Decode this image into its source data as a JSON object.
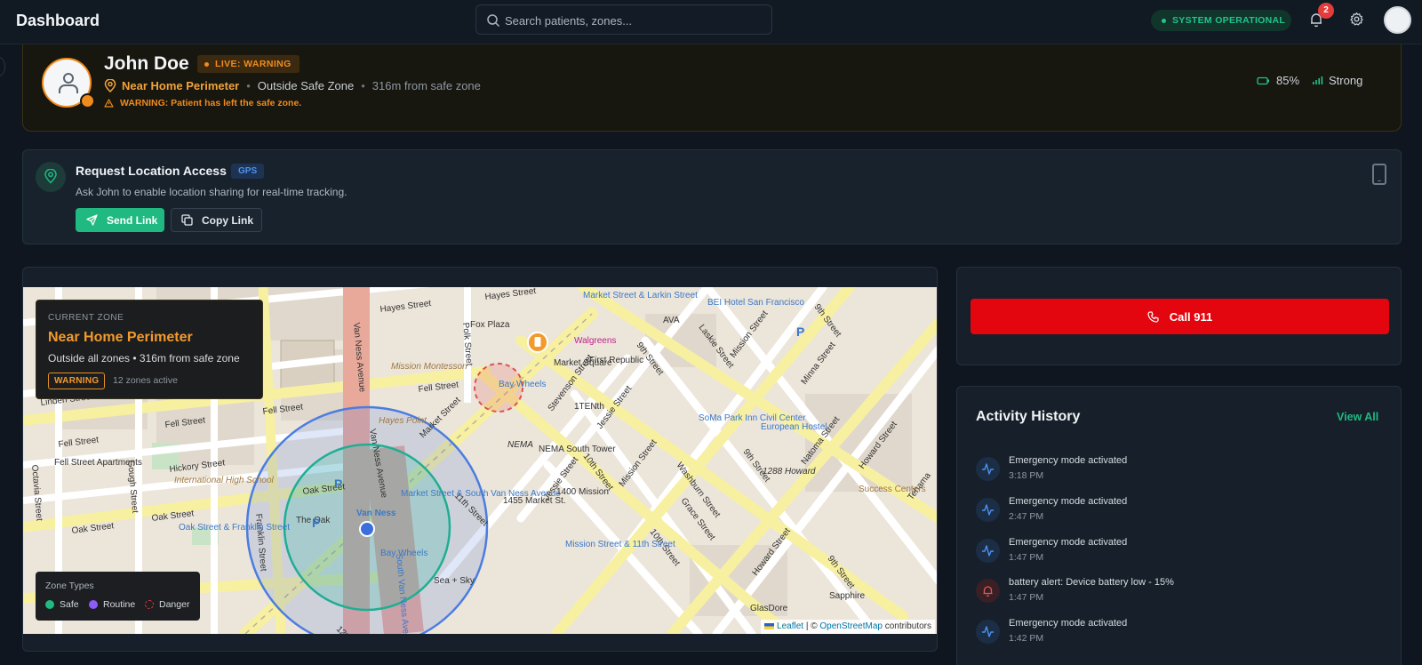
{
  "header": {
    "title": "Dashboard",
    "search_placeholder": "Search patients, zones...",
    "system_status": "SYSTEM OPERATIONAL",
    "notification_count": "2"
  },
  "patient": {
    "name": "John Doe",
    "live_badge": "LIVE: WARNING",
    "zone": "Near Home Perimeter",
    "zone_status": "Outside Safe Zone",
    "distance": "316m from safe zone",
    "warning": "WARNING: Patient has left the safe zone.",
    "battery": "85%",
    "signal": "Strong"
  },
  "location_request": {
    "title": "Request Location Access",
    "badge": "GPS",
    "description": "Ask John to enable location sharing for real-time tracking.",
    "send_label": "Send Link",
    "copy_label": "Copy Link"
  },
  "map": {
    "overlay": {
      "label": "CURRENT ZONE",
      "zone_name": "Near Home Perimeter",
      "subtitle": "Outside all zones • 316m from safe zone",
      "status": "WARNING",
      "zones_active": "12 zones active"
    },
    "legend": {
      "title": "Zone Types",
      "items": [
        {
          "label": "Safe",
          "color": "#1fb981"
        },
        {
          "label": "Routine",
          "color": "#8b5cf6"
        },
        {
          "label": "Danger",
          "color": "#e23c3c"
        }
      ]
    },
    "attribution": {
      "leaflet": "Leaflet",
      "separator": "| ©",
      "osm": "OpenStreetMap",
      "suffix": "contributors"
    },
    "labels": {
      "hayes_street": "Hayes Street",
      "fell_street": "Fell Street",
      "oak_street": "Oak Street",
      "market_street": "Market Street",
      "van_ness": "Van Ness",
      "van_ness_avenue": "Van Ness Avenue",
      "mission_street": "Mission Street",
      "howard_street": "Howard Street",
      "tenth_street": "10th Street",
      "ninth_street": "9th Street",
      "twelfth_street": "12th Street",
      "franklin_street": "Franklin Street",
      "gough_street": "Gough Street",
      "jessie_street": "Jessie Street",
      "stevenson_street": "Stevenson Street",
      "natoma_street": "Natoma Street",
      "washburn_street": "Washburn Street",
      "grace_street": "Grace Street",
      "polk_street": "Polk Street",
      "linden_street": "Linden Street",
      "hickory_street": "Hickory Street",
      "octavia_street": "Octavia Street",
      "minna_street": "Minna Street",
      "laskie_street": "Laskie Street",
      "eleventh_street": "11th Street",
      "south_van_ness": "South Van Ness Avenue",
      "fox_plaza": "Fox Plaza",
      "market_square": "Market Square",
      "walgreens": "Walgreens",
      "first_republic": "First Republic",
      "nema": "NEMA",
      "nema_tower": "NEMA South Tower",
      "mission_1400": "1400 Mission",
      "market_1455": "1455 Market St.",
      "the_oak": "The Oak",
      "bay_wheels": "Bay Wheels",
      "tententh": "1TENth",
      "soma_park": "SoMa Park Inn Civil Center",
      "european_hostel": "European Hostel",
      "bei_hotel": "BEI Hotel San Francisco",
      "success_centers": "Success Centers",
      "glasdore": "GlasDore",
      "sapphire": "Sapphire",
      "sea_sky": "Sea + Sky",
      "ava": "AVA",
      "hayes_point": "Hayes Point",
      "intl_school": "International High School",
      "mission_montessori": "Mission Montessori",
      "fell_apartments": "Fell Street Apartments",
      "oak_franklin": "Oak Street & Franklin Street",
      "mission_11th": "Mission Street & 11th Street",
      "market_van_ness": "Market Street & South Van Ness Avenue",
      "market_larkin": "Market Street & Larkin Street",
      "howard_1288": "1288 Howard",
      "tehama": "Tehama"
    }
  },
  "emergency": {
    "call_label": "Call 911"
  },
  "activity": {
    "title": "Activity History",
    "view_all": "View All",
    "items": [
      {
        "text": "Emergency mode activated",
        "time": "3:18 PM",
        "icon": "activity-icon"
      },
      {
        "text": "Emergency mode activated",
        "time": "2:47 PM",
        "icon": "activity-icon"
      },
      {
        "text": "Emergency mode activated",
        "time": "1:47 PM",
        "icon": "activity-icon"
      },
      {
        "text": "battery alert: Device battery low - 15%",
        "time": "1:47 PM",
        "icon": "bell-icon"
      },
      {
        "text": "Emergency mode activated",
        "time": "1:42 PM",
        "icon": "activity-icon"
      }
    ]
  },
  "colors": {
    "accent_green": "#1fb981",
    "warning_orange": "#f08b1e",
    "danger_red": "#e3060f"
  }
}
